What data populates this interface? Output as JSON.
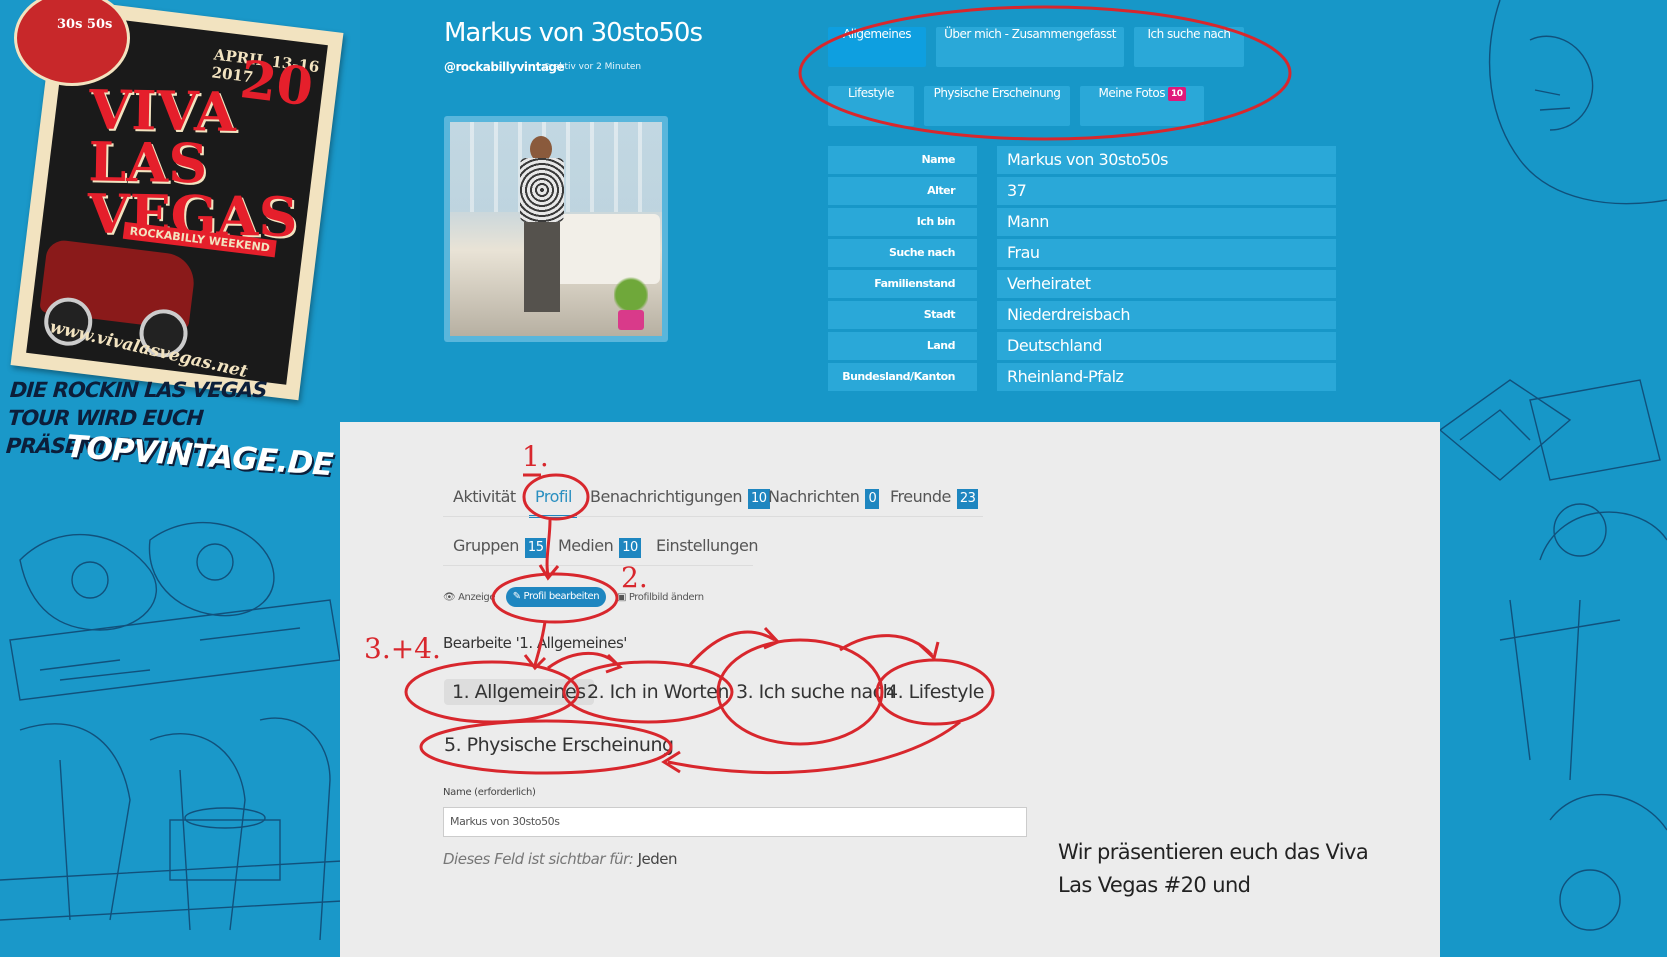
{
  "colors": {
    "background": "#1797c8",
    "field_bg": "#2aa8d8",
    "annotation_red": "#d8272d",
    "badge_pink": "#e0187a",
    "count_badge": "#1e86c0",
    "panel_bg": "#ececec"
  },
  "left_art": {
    "poster": {
      "date": "APRIL 13-16 2017",
      "number": "20",
      "title": "VIVA LAS VEGAS",
      "subtitle": "ROCKABILLY WEEKEND",
      "url": "www.vivalasvegas.net",
      "badge": "30s 50s"
    },
    "tour_text": "DIE ROCKIN LAS VEGAS TOUR WIRD EUCH PRÄSENTIERT VON",
    "logo": "TOPVINTAGE.DE"
  },
  "profile": {
    "name": "Markus von 30sto50s",
    "handle": "@rockabillyvintage",
    "active_icon": "clock-icon",
    "active": "aktiv vor 2 Minuten"
  },
  "profile_tabs": [
    {
      "label": "Allgemeines"
    },
    {
      "label": "Über mich - Zusammengefasst"
    },
    {
      "label": "Ich suche nach"
    },
    {
      "label": "Lifestyle"
    },
    {
      "label": "Physische Erscheinung"
    },
    {
      "label": "Meine Fotos",
      "badge": "10"
    }
  ],
  "details": [
    {
      "label": "Name",
      "value": "Markus von 30sto50s"
    },
    {
      "label": "Alter",
      "value": "37"
    },
    {
      "label": "Ich bin",
      "value": "Mann"
    },
    {
      "label": "Suche nach",
      "value": "Frau"
    },
    {
      "label": "Familienstand",
      "value": "Verheiratet"
    },
    {
      "label": "Stadt",
      "value": "Niederdreisbach"
    },
    {
      "label": "Land",
      "value": "Deutschland"
    },
    {
      "label": "Bundesland/Kanton",
      "value": "Rheinland-Pfalz"
    }
  ],
  "nav": {
    "items": [
      {
        "label": "Aktivität"
      },
      {
        "label": "Profil"
      },
      {
        "label": "Benachrichtigungen",
        "count": "10"
      },
      {
        "label": "Nachrichten",
        "count": "0"
      },
      {
        "label": "Freunde",
        "count": "23"
      }
    ],
    "items_row2": [
      {
        "label": "Gruppen",
        "count": "15"
      },
      {
        "label": "Medien",
        "count": "10"
      },
      {
        "label": "Einstellungen"
      }
    ]
  },
  "sub_nav": {
    "view_icon": "eye-icon",
    "view": "Anzeige",
    "edit_icon": "pencil-icon",
    "edit": "Profil bearbeiten",
    "photo_icon": "image-icon",
    "photo": "Profilbild ändern"
  },
  "edit_heading": "Bearbeite '1. Allgemeines'",
  "steps": [
    {
      "label": "1. Allgemeines"
    },
    {
      "label": "2. Ich in Worten"
    },
    {
      "label": "3. Ich suche nach"
    },
    {
      "label": "4. Lifestyle"
    },
    {
      "label": "5. Physische Erscheinung"
    }
  ],
  "form": {
    "name_label": "Name (erforderlich)",
    "name_value": "Markus von 30sto50s",
    "visibility_prefix": "Dieses Feld ist sichtbar für:",
    "visibility_value": "Jeden"
  },
  "annotations": {
    "step1": "1.",
    "step2": "2.",
    "step34": "3.+4."
  },
  "present_text": "Wir präsentieren euch das Viva Las Vegas #20 und"
}
